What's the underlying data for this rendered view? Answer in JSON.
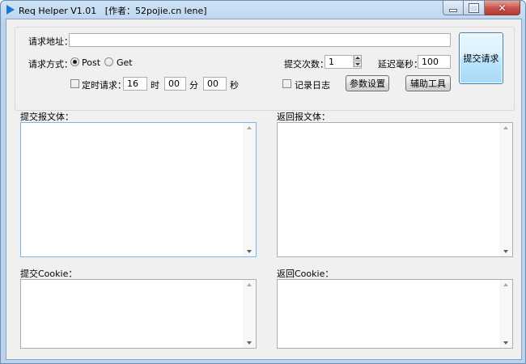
{
  "window": {
    "title": "Req Helper V1.01   [作者：52pojie.cn lene]"
  },
  "request": {
    "url_label": "请求地址：",
    "url_value": "",
    "method_label": "请求方式：",
    "method_post": "Post",
    "method_get": "Get",
    "selected_method": "Post",
    "submit_count_label": "提交次数：",
    "submit_count_value": "1",
    "delay_label": "延迟毫秒：",
    "delay_value": "100",
    "timed_label": "定时请求：",
    "timed_checked": false,
    "hour_value": "16",
    "hour_unit": "时",
    "minute_value": "00",
    "minute_unit": "分",
    "second_value": "00",
    "second_unit": "秒",
    "log_label": "记录日志",
    "log_checked": false,
    "param_settings_button": "参数设置",
    "tools_button": "辅助工具",
    "submit_button": "提交请求"
  },
  "panels": {
    "submit_body_label": "提交报文体：",
    "return_body_label": "返回报文体：",
    "submit_cookie_label": "提交Cookie：",
    "return_cookie_label": "返回Cookie："
  },
  "icons": {
    "app": "play-arrow-icon",
    "minimize": "minimize-icon",
    "maximize": "maximize-icon",
    "close": "close-icon"
  },
  "colors": {
    "accent": "#1f78d1",
    "close_button": "#c75050",
    "window_background": "#f0f0f0"
  }
}
